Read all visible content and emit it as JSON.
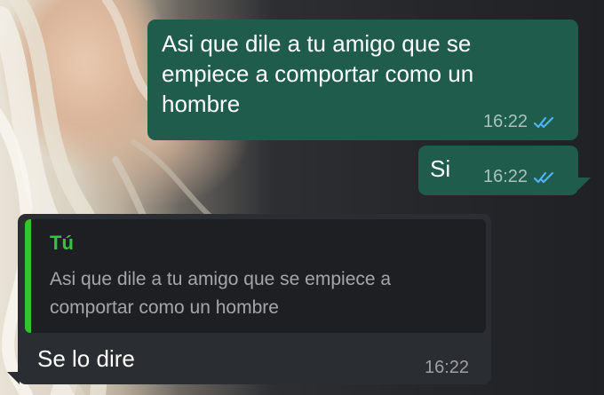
{
  "conversation": {
    "messages": [
      {
        "direction": "outgoing",
        "text": "Asi que dile a tu amigo que se\nempiece a comportar como un\nhombre",
        "time": "16:22",
        "status": "read"
      },
      {
        "direction": "outgoing",
        "text": "Si",
        "time": "16:22",
        "status": "read"
      },
      {
        "direction": "incoming",
        "quote": {
          "author": "Tú",
          "text": "Asi que dile a tu amigo que se empiece a comportar como un hombre"
        },
        "text": "Se lo dire",
        "time": "16:22"
      }
    ]
  },
  "colors": {
    "outgoing_bubble": "#1f5c4c",
    "incoming_bubble": "#2a2d31",
    "quote_accent": "#31c334",
    "read_ticks": "#4fb3f6"
  },
  "icons": {
    "read_status": "double-check-icon"
  }
}
